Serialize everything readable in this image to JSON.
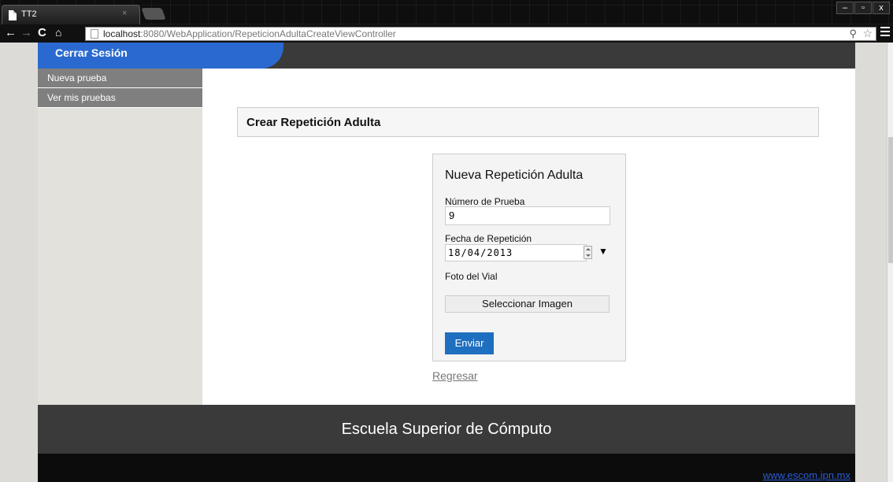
{
  "browser": {
    "tab_title": "TT2",
    "tab_close": "×",
    "url_host": "localhost",
    "url_rest": ":8080/WebApplication/RepeticionAdultaCreateViewController",
    "window_controls": [
      "–",
      "▫",
      "x"
    ]
  },
  "header": {
    "logout_label": "Cerrar Sesión"
  },
  "sidebar": {
    "items": [
      {
        "label": "Nueva prueba"
      },
      {
        "label": "Ver mis pruebas"
      }
    ]
  },
  "main": {
    "page_title": "Crear Repetición Adulta",
    "form": {
      "title": "Nueva Repetición Adulta",
      "test_number_label": "Número de Prueba",
      "test_number_value": "9",
      "date_label": "Fecha de Repetición",
      "date_value": "18/04/2013",
      "photo_label": "Foto del Vial",
      "select_image_button": "Seleccionar Imagen",
      "submit_button": "Enviar"
    },
    "back_link": "Regresar"
  },
  "footer": {
    "title": "Escuela Superior de Cómputo",
    "link": "www.escom.ipn.mx"
  },
  "colors": {
    "accent": "#2a6ad0",
    "header_bg": "#3a3a3a",
    "submit_bg": "#1e6fbf",
    "sidebar_item_bg": "#7f7f7f"
  }
}
